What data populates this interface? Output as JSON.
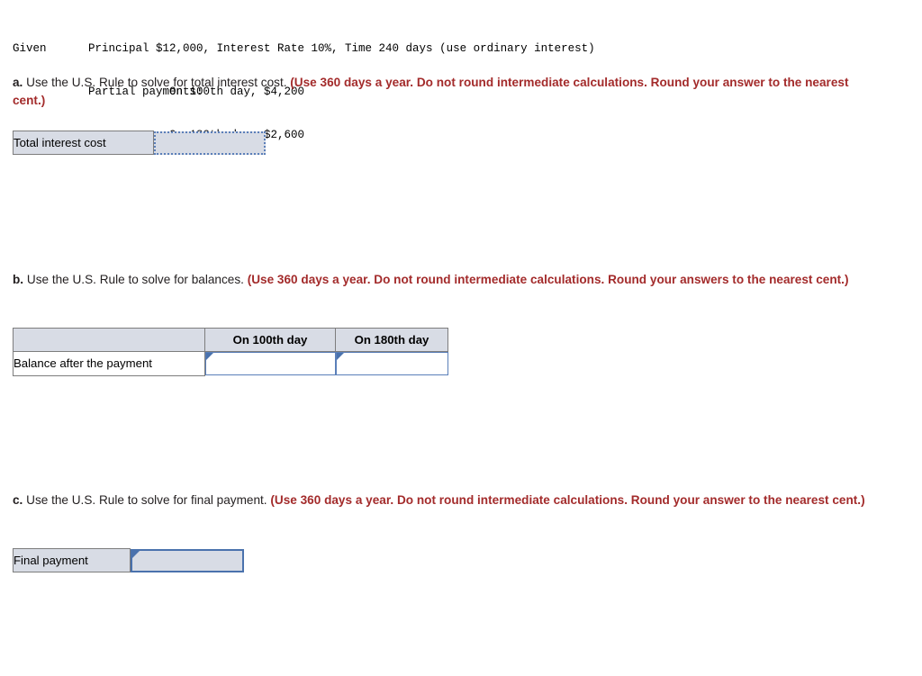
{
  "given": {
    "label": "Given",
    "line1": "Principal $12,000, Interest Rate 10%, Time 240 days (use ordinary interest)",
    "partial_label": "Partial payments:",
    "payment1": "On 100th day, $4,200",
    "payment2": "On 180th day, $2,600"
  },
  "questions": {
    "a": {
      "letter": "a.",
      "text": " Use the U.S. Rule to solve for total interest cost. ",
      "note": "(Use 360 days a year. Do not round intermediate calculations. Round your answer to the nearest cent.)"
    },
    "b": {
      "letter": "b.",
      "text": " Use the U.S. Rule to solve for balances. ",
      "note": "(Use 360 days a year. Do not round intermediate calculations. Round your answers to the nearest cent.)"
    },
    "c": {
      "letter": "c.",
      "text": " Use the U.S. Rule to solve for final payment. ",
      "note": "(Use 360 days a year. Do not round intermediate calculations. Round your answer to the nearest cent.)"
    }
  },
  "table_a": {
    "row_label": "Total interest cost",
    "answer_value": "",
    "answer_placeholder": ""
  },
  "table_b": {
    "corner_header": "",
    "headers": [
      "On 100th day",
      "On 180th day"
    ],
    "row_label": "Balance after the payment",
    "answers": [
      "",
      ""
    ],
    "placeholders": [
      "",
      ""
    ]
  },
  "table_c": {
    "row_label": "Final payment",
    "answer_value": "",
    "answer_placeholder": ""
  },
  "colors": {
    "note_red": "#a32b2b",
    "cell_fill": "#d8dce5",
    "cell_border": "#7d7d7d",
    "input_border_blue": "#5b7fb9",
    "input_border_blue_strong": "#4a72ad",
    "text": "#231f20"
  }
}
